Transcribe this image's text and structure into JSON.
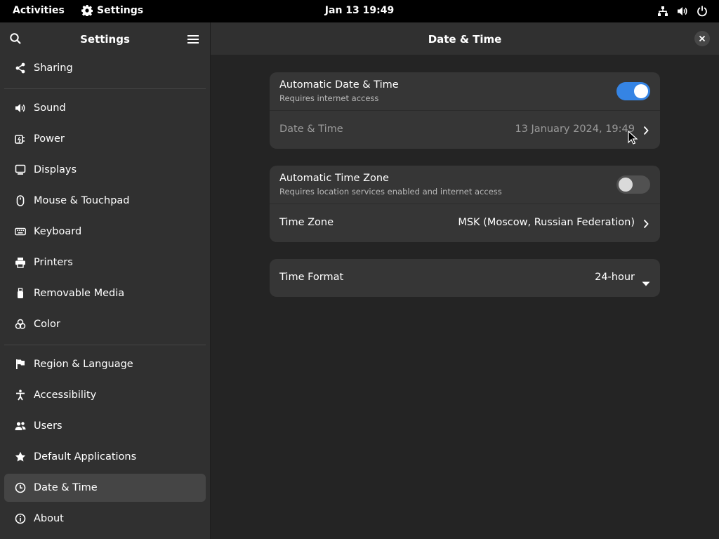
{
  "topbar": {
    "activities": "Activities",
    "app_name": "Settings",
    "clock": "Jan 13  19:49",
    "icons": [
      "network-icon",
      "volume-icon",
      "power-icon"
    ]
  },
  "sidebar": {
    "title": "Settings",
    "items": [
      {
        "label": "Sharing",
        "icon": "share-icon"
      },
      {
        "label": "Sound",
        "icon": "speaker-icon"
      },
      {
        "label": "Power",
        "icon": "power-plug-icon"
      },
      {
        "label": "Displays",
        "icon": "display-icon"
      },
      {
        "label": "Mouse & Touchpad",
        "icon": "mouse-icon"
      },
      {
        "label": "Keyboard",
        "icon": "keyboard-icon"
      },
      {
        "label": "Printers",
        "icon": "printer-icon"
      },
      {
        "label": "Removable Media",
        "icon": "usb-drive-icon"
      },
      {
        "label": "Color",
        "icon": "color-icon"
      },
      {
        "label": "Region & Language",
        "icon": "flag-icon"
      },
      {
        "label": "Accessibility",
        "icon": "accessibility-icon"
      },
      {
        "label": "Users",
        "icon": "users-icon"
      },
      {
        "label": "Default Applications",
        "icon": "star-icon"
      },
      {
        "label": "Date & Time",
        "icon": "clock-icon",
        "selected": true
      },
      {
        "label": "About",
        "icon": "info-icon"
      }
    ]
  },
  "main": {
    "title": "Date & Time",
    "auto_datetime": {
      "title": "Automatic Date & Time",
      "subtitle": "Requires internet access",
      "enabled": true
    },
    "datetime": {
      "title": "Date & Time",
      "value": "13 January 2024, 19:49"
    },
    "auto_timezone": {
      "title": "Automatic Time Zone",
      "subtitle": "Requires location services enabled and internet access",
      "enabled": false
    },
    "timezone": {
      "title": "Time Zone",
      "value": "MSK (Moscow, Russian Federation)"
    },
    "time_format": {
      "title": "Time Format",
      "value": "24-hour"
    }
  },
  "colors": {
    "accent": "#3584e4",
    "window_bg": "#242424",
    "sidebar_bg": "#303030",
    "card_bg": "#363636"
  }
}
